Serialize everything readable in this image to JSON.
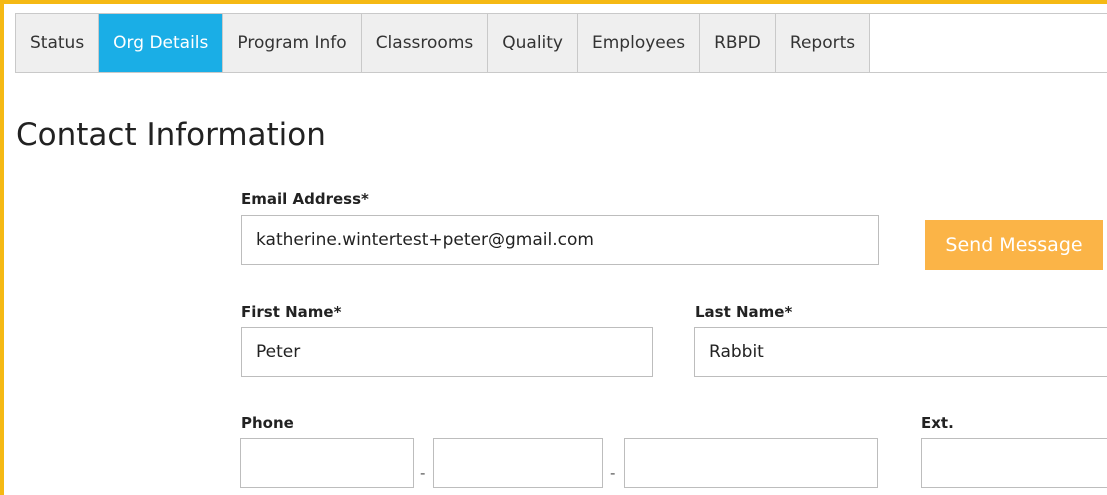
{
  "tabs": [
    {
      "label": "Status",
      "active": false
    },
    {
      "label": "Org Details",
      "active": true
    },
    {
      "label": "Program Info",
      "active": false
    },
    {
      "label": "Classrooms",
      "active": false
    },
    {
      "label": "Quality",
      "active": false
    },
    {
      "label": "Employees",
      "active": false
    },
    {
      "label": "RBPD",
      "active": false
    },
    {
      "label": "Reports",
      "active": false
    }
  ],
  "section": {
    "title": "Contact Information"
  },
  "form": {
    "email": {
      "label": "Email Address*",
      "value": "katherine.wintertest+peter@gmail.com"
    },
    "send_button": "Send Message",
    "first_name": {
      "label": "First Name*",
      "value": "Peter"
    },
    "last_name": {
      "label": "Last Name*",
      "value": "Rabbit"
    },
    "phone": {
      "label": "Phone",
      "part1": "",
      "part2": "",
      "part3": "",
      "separator": "-"
    },
    "ext": {
      "label": "Ext.",
      "value": ""
    }
  },
  "colors": {
    "accent_border": "#f5b914",
    "active_tab": "#1aaee6",
    "send_button": "#fbb447"
  }
}
